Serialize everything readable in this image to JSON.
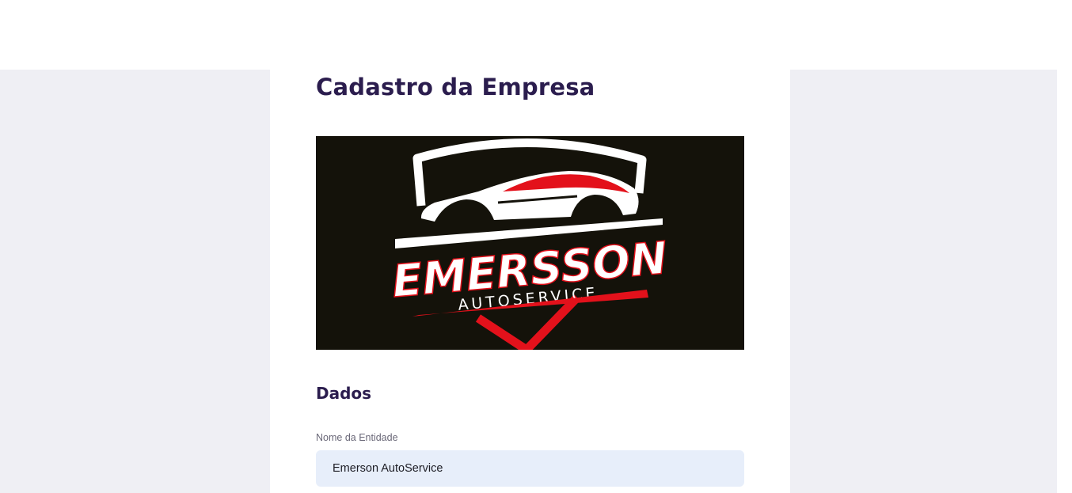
{
  "page": {
    "title": "Cadastro da Empresa"
  },
  "logo": {
    "name_text": "EMERSSON",
    "subtitle_text": "AUTOSERVICE",
    "colors": {
      "background": "#14120a",
      "accent_red": "#e3111b",
      "white": "#ffffff"
    }
  },
  "section": {
    "title": "Dados"
  },
  "fields": {
    "entity_name": {
      "label": "Nome da Entidade",
      "value": "Emerson AutoService"
    }
  },
  "colors": {
    "heading": "#2b1d4e",
    "page_background": "#efeff4",
    "input_background": "#e7eefa"
  }
}
